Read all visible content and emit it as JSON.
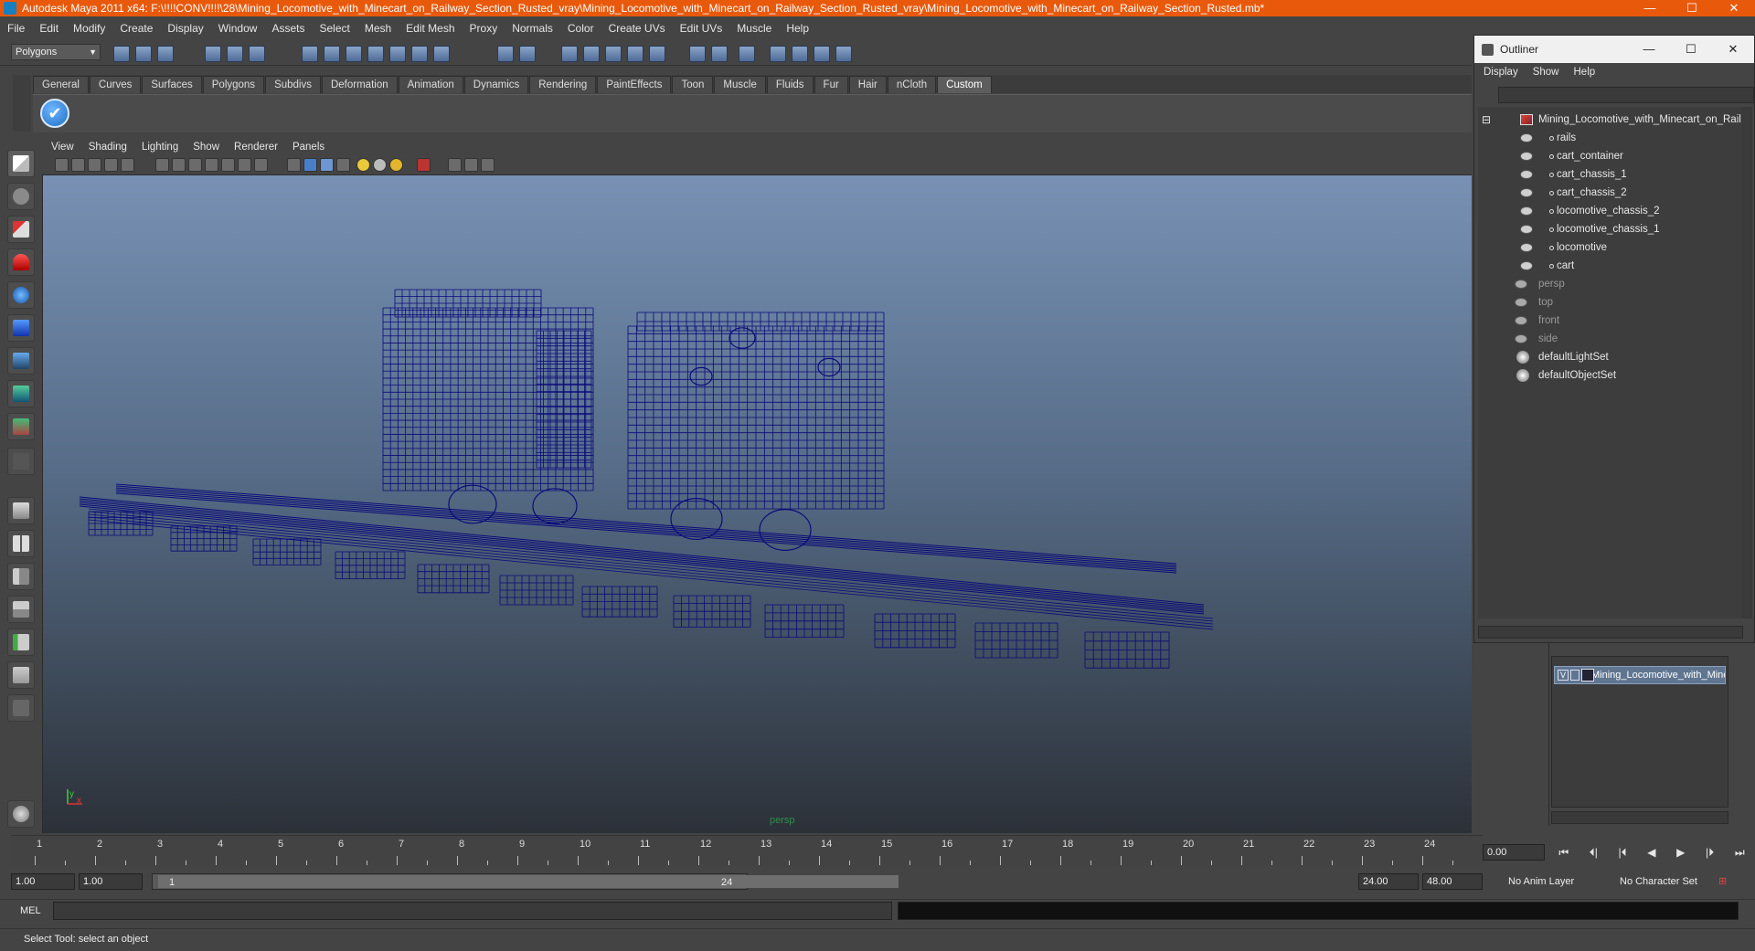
{
  "window": {
    "title": "Autodesk Maya 2011 x64: F:\\!!!!CONV!!!!\\28\\Mining_Locomotive_with_Minecart_on_Railway_Section_Rusted_vray\\Mining_Locomotive_with_Minecart_on_Railway_Section_Rusted_vray\\Mining_Locomotive_with_Minecart_on_Railway_Section_Rusted.mb*",
    "controls": [
      "—",
      "☐",
      "✕"
    ],
    "accent_color": "#e8590c"
  },
  "menubar": [
    "File",
    "Edit",
    "Modify",
    "Create",
    "Display",
    "Window",
    "Assets",
    "Select",
    "Mesh",
    "Edit Mesh",
    "Proxy",
    "Normals",
    "Color",
    "Create UVs",
    "Edit UVs",
    "Muscle",
    "Help"
  ],
  "statusline": {
    "mode": "Polygons"
  },
  "shelf": {
    "tabs": [
      "General",
      "Curves",
      "Surfaces",
      "Polygons",
      "Subdivs",
      "Deformation",
      "Animation",
      "Dynamics",
      "Rendering",
      "PaintEffects",
      "Toon",
      "Muscle",
      "Fluids",
      "Fur",
      "Hair",
      "nCloth",
      "Custom"
    ],
    "active_tab": "Custom",
    "button_glyph": "✔"
  },
  "panel": {
    "menu": [
      "View",
      "Shading",
      "Lighting",
      "Show",
      "Renderer",
      "Panels"
    ],
    "camera_label": "persp",
    "axis_x": "x",
    "axis_y": "y",
    "wire_color": "#0a0a7a"
  },
  "outliner": {
    "title": "Outliner",
    "window_controls": [
      "—",
      "☐",
      "✕"
    ],
    "menu": [
      "Display",
      "Show",
      "Help"
    ],
    "root": "Mining_Locomotive_with_Minecart_on_Railway_Section_Rusted",
    "children": [
      "rails",
      "cart_container",
      "cart_chassis_1",
      "cart_chassis_2",
      "locomotive_chassis_2",
      "locomotive_chassis_1",
      "locomotive",
      "cart"
    ],
    "cameras": [
      "persp",
      "top",
      "front",
      "side"
    ],
    "sets": [
      "defaultLightSet",
      "defaultObjectSet"
    ],
    "collapse_glyph": "⊟"
  },
  "layers": {
    "row": "Mining_Locomotive_with_Minecart_on_Railway_Section_Rusted",
    "visible_mark": "V"
  },
  "timeline": {
    "ticks": [
      "1",
      "2",
      "3",
      "4",
      "5",
      "6",
      "7",
      "8",
      "9",
      "10",
      "11",
      "12",
      "13",
      "14",
      "15",
      "16",
      "17",
      "18",
      "19",
      "20",
      "21",
      "22",
      "23",
      "24"
    ],
    "current_frame": "0.00",
    "play_controls": [
      "⏮",
      "⏴|",
      "|⏴",
      "◀",
      "▶",
      "|⏵",
      "⏭"
    ]
  },
  "range": {
    "start": "1.00",
    "start2": "1.00",
    "slider_start": "1",
    "slider_end": "24",
    "end": "24.00",
    "end2": "48.00",
    "anim_layer": "No Anim Layer",
    "character_set": "No Character Set"
  },
  "mel": {
    "label": "MEL"
  },
  "helpline": "Select Tool: select an object"
}
